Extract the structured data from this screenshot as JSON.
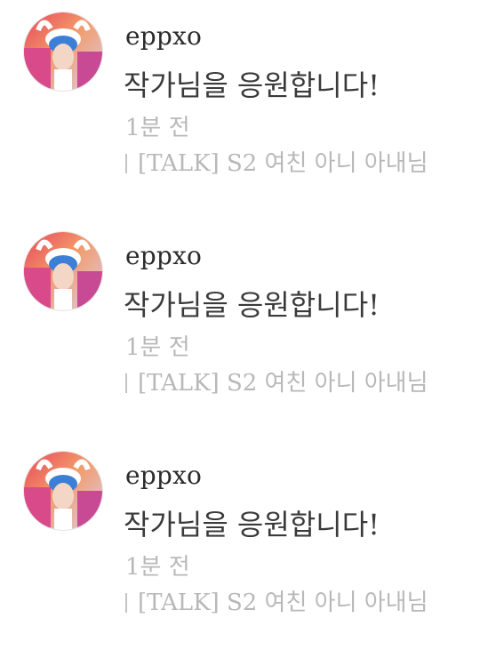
{
  "comments": [
    {
      "username": "eppxo",
      "message": "작가님을 응원합니다!",
      "time": "1분 전",
      "source": "[TALK] S2 여친 아니 아내님"
    },
    {
      "username": "eppxo",
      "message": "작가님을 응원합니다!",
      "time": "1분 전",
      "source": "[TALK] S2 여친 아니 아내님"
    },
    {
      "username": "eppxo",
      "message": "작가님을 응원합니다!",
      "time": "1분 전",
      "source": "[TALK] S2 여친 아니 아내님"
    }
  ],
  "colors": {
    "username": "#2b2b2b",
    "message": "#3a3a3a",
    "meta": "#b8b8b8"
  },
  "icons": {
    "avatar": "user-avatar-photo",
    "separator": "vertical-bar-divider"
  }
}
